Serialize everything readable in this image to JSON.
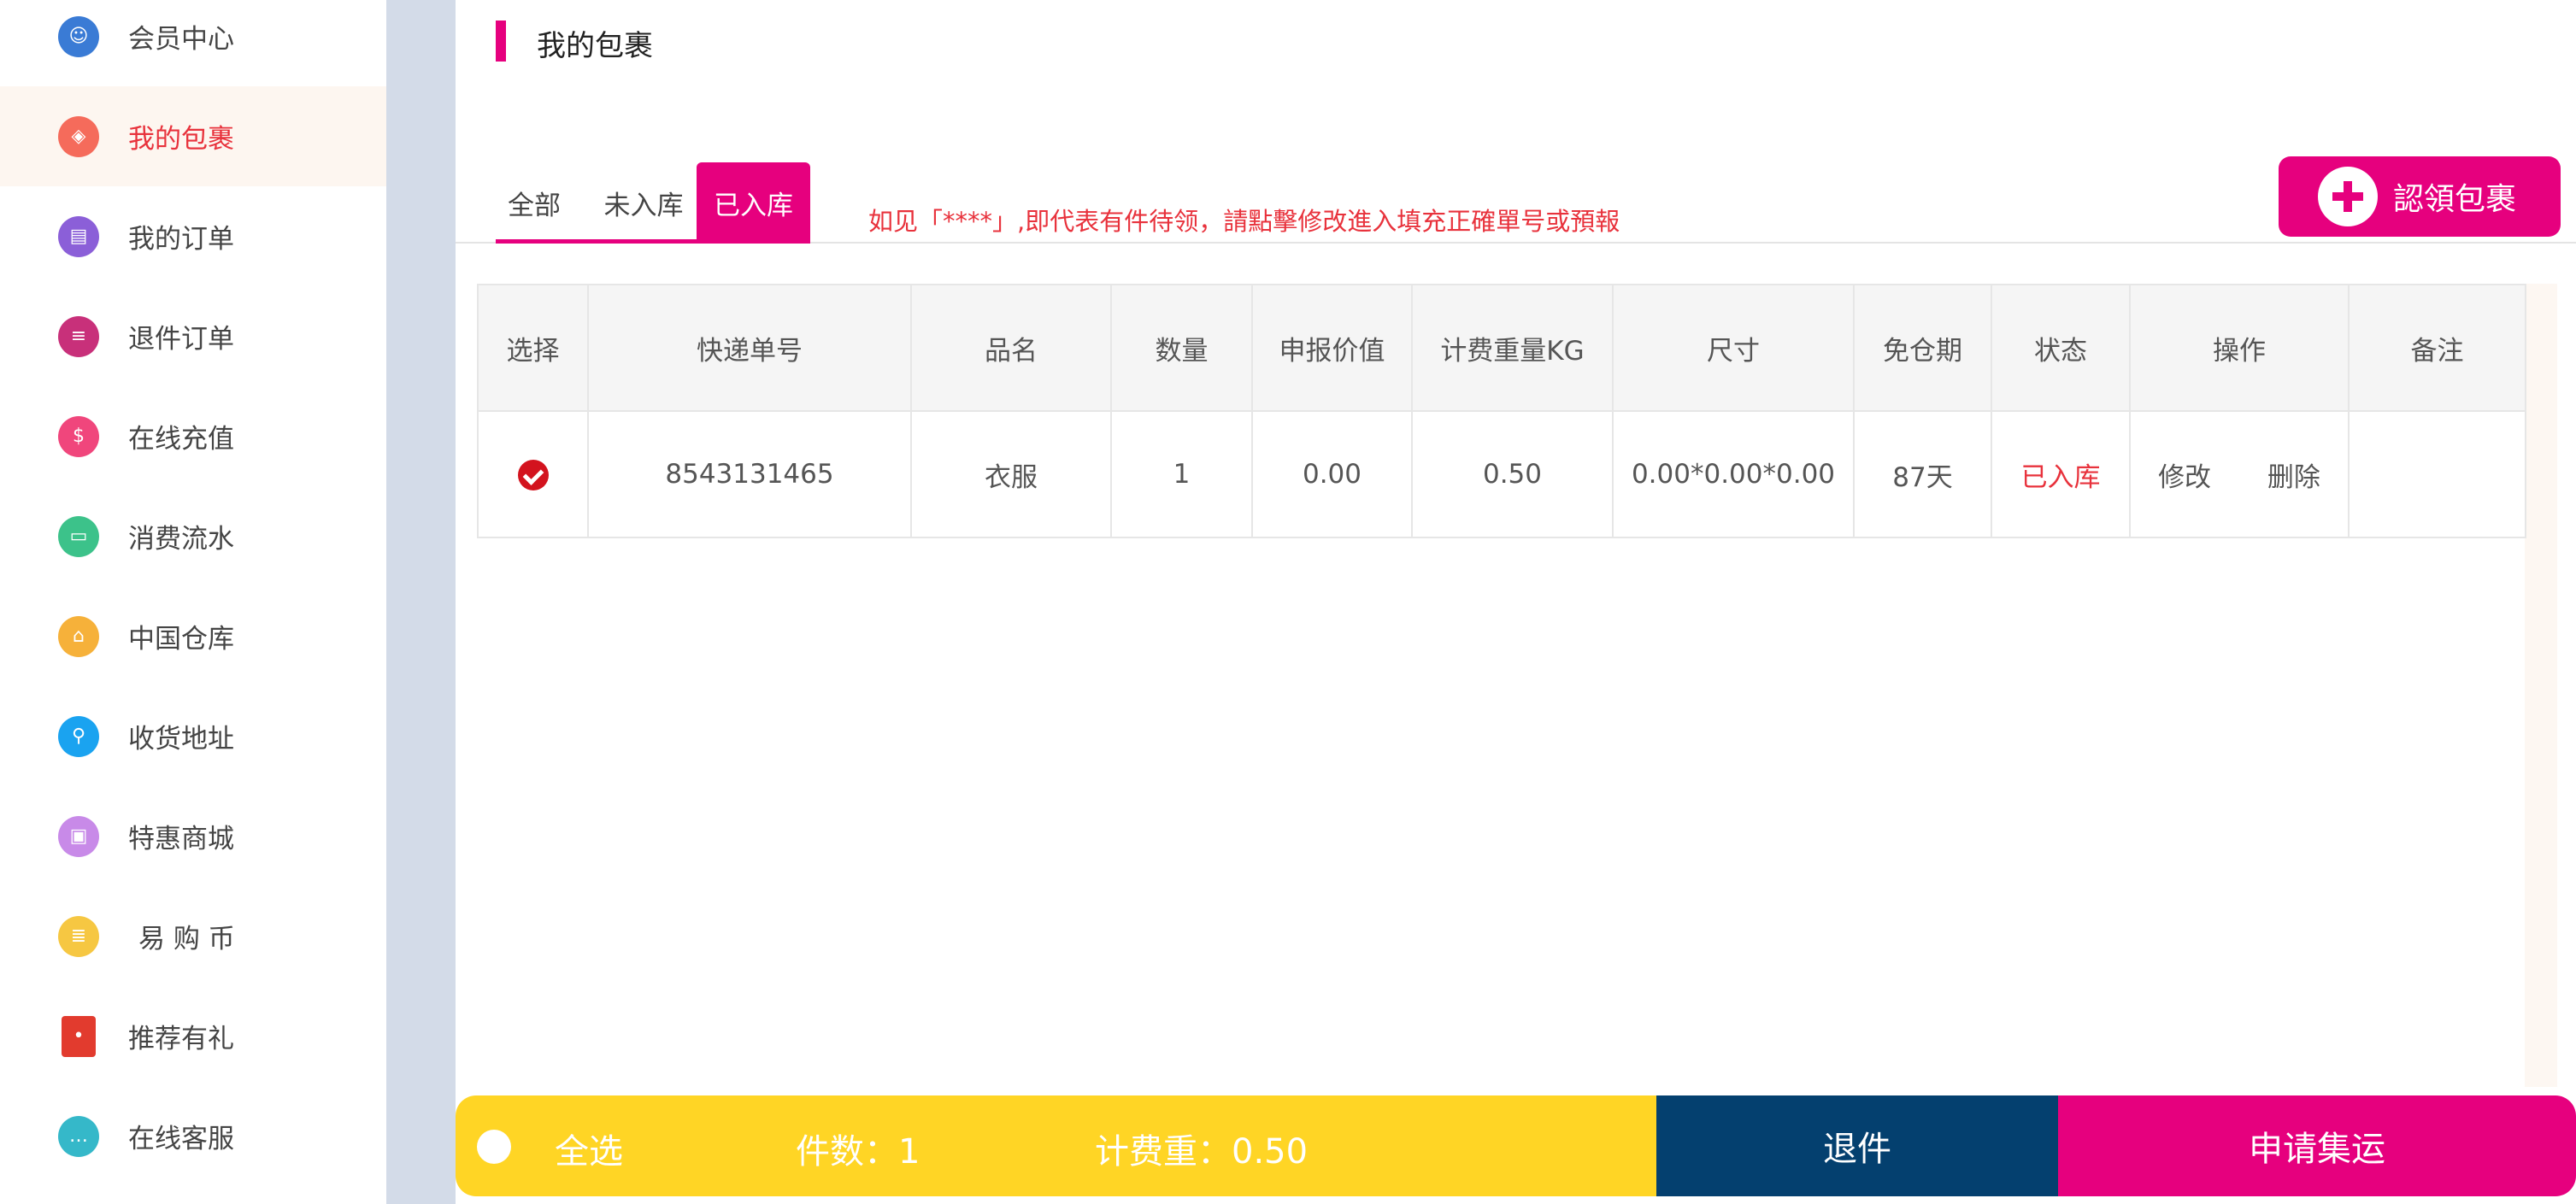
{
  "sidebar": {
    "items": [
      {
        "label": "会员中心",
        "icon": "member-icon",
        "color": "#3a7bd5"
      },
      {
        "label": "我的包裹",
        "icon": "package-icon",
        "color": "#f56b5b",
        "active": true
      },
      {
        "label": "我的订单",
        "icon": "order-icon",
        "color": "#8b5fd8"
      },
      {
        "label": "退件订单",
        "icon": "return-order-icon",
        "color": "#c8307a"
      },
      {
        "label": "在线充值",
        "icon": "recharge-icon",
        "color": "#f0467c"
      },
      {
        "label": "消费流水",
        "icon": "bill-icon",
        "color": "#3cc28a"
      },
      {
        "label": "中国仓库",
        "icon": "warehouse-icon",
        "color": "#f6b13a"
      },
      {
        "label": "收货地址",
        "icon": "location-icon",
        "color": "#1aa3f0"
      },
      {
        "label": "特惠商城",
        "icon": "mall-icon",
        "color": "#c88ae8"
      },
      {
        "label": "易 购 币",
        "icon": "coin-icon",
        "color": "#f6c742"
      },
      {
        "label": "推荐有礼",
        "icon": "red-envelope-icon",
        "color": "#e23b2e"
      },
      {
        "label": "在线客服",
        "icon": "chat-icon",
        "color": "#35b8c9"
      }
    ]
  },
  "header": {
    "title": "我的包裹"
  },
  "tabs": [
    {
      "label": "全部"
    },
    {
      "label": "未入库"
    },
    {
      "label": "已入库",
      "active": true
    }
  ],
  "notice": "如见「****」,即代表有件待领，請點擊修改進入填充正確單号或預報",
  "claim_button": {
    "label": "認領包裹"
  },
  "table": {
    "columns": [
      "选择",
      "快递单号",
      "品名",
      "数量",
      "申报价值",
      "计费重量KG",
      "尺寸",
      "免仓期",
      "状态",
      "操作",
      "备注"
    ],
    "rows": [
      {
        "selected": true,
        "tracking_no": "8543131465",
        "item_name": "衣服",
        "quantity": "1",
        "declared_value": "0.00",
        "billable_weight": "0.50",
        "size": "0.00*0.00*0.00",
        "free_storage": "87天",
        "status": "已入库",
        "edit_label": "修改",
        "delete_label": "删除",
        "remark": ""
      }
    ]
  },
  "bottom_bar": {
    "select_all": "全选",
    "count_text": "件数：1",
    "weight_text": "计费重：0.50",
    "return_label": "退件",
    "consolidate_label": "申请集运"
  },
  "colors": {
    "accent": "#e6007e",
    "alert": "#e8323c",
    "navy": "#04406f",
    "yellow": "#ffd525"
  }
}
